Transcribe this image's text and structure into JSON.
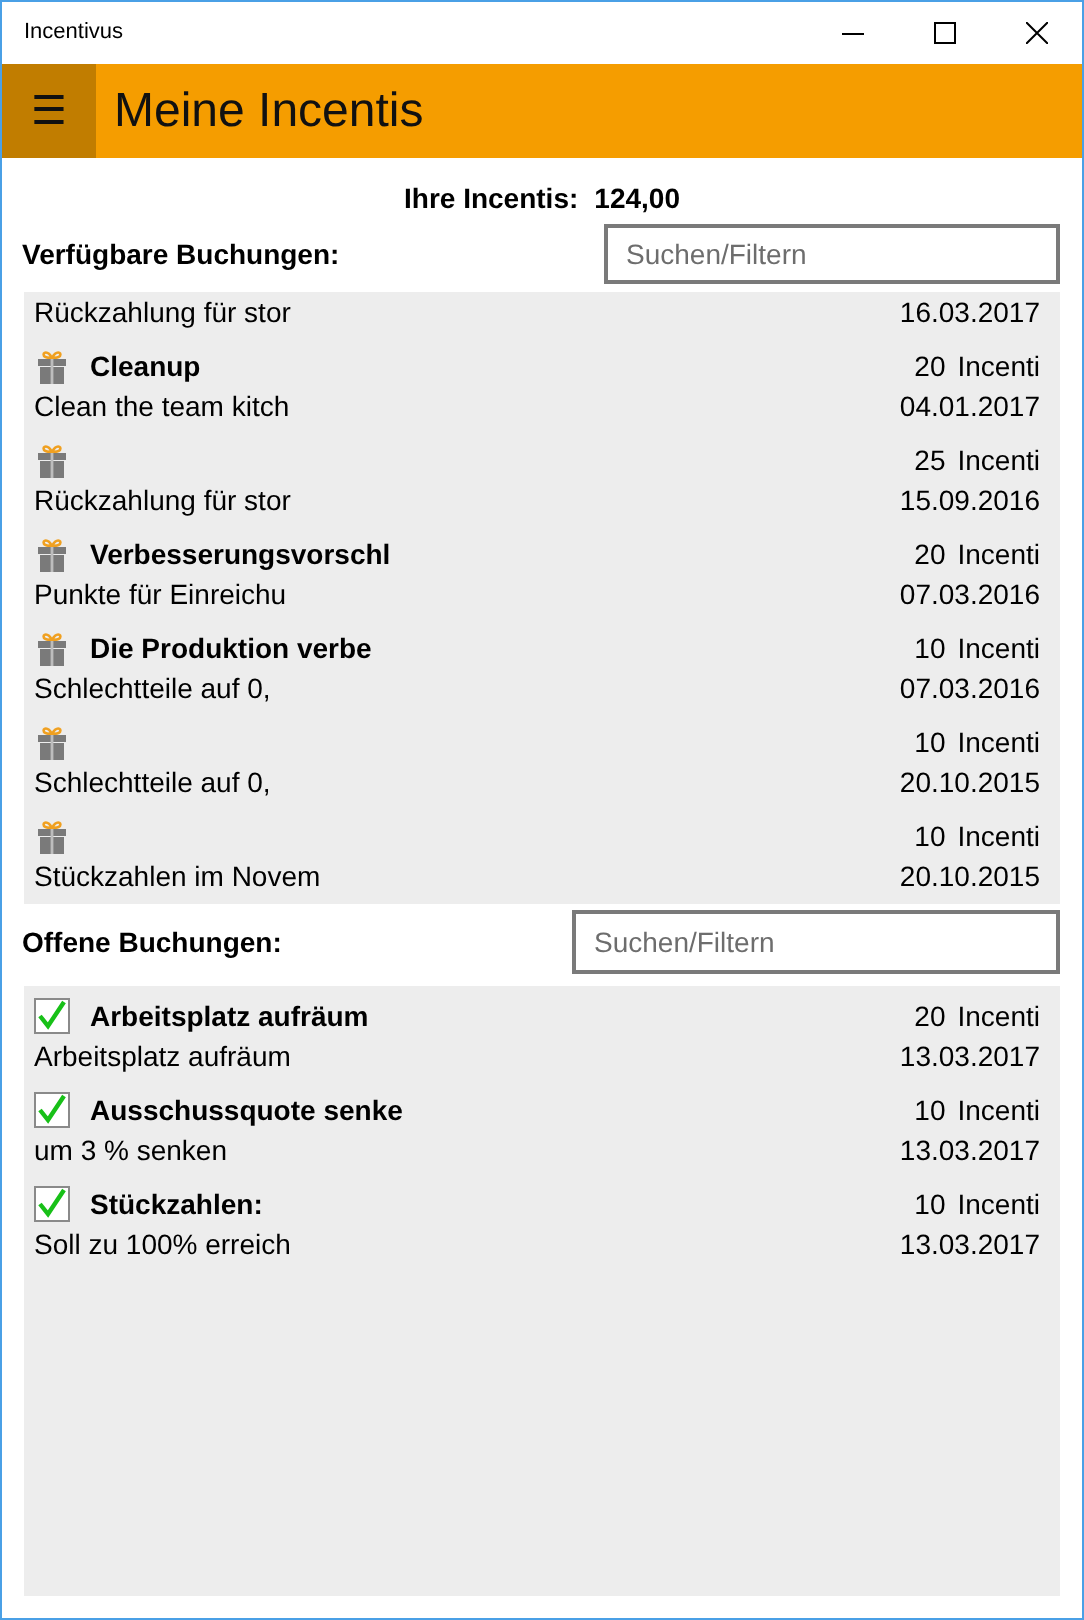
{
  "window": {
    "title": "Incentivus"
  },
  "header": {
    "menu_icon": "☰",
    "title": "Meine Incentis"
  },
  "total": {
    "label": "Ihre Incentis:",
    "value": "124,00"
  },
  "available": {
    "heading": "Verfügbare Buchungen:",
    "search": {
      "placeholder": "Suchen/Filtern"
    },
    "items": [
      {
        "description": "Rückzahlung für stor",
        "date": "16.03.2017"
      },
      {
        "kind": "gift",
        "title": "Cleanup",
        "points": "20",
        "unit": "Incenti",
        "description": "Clean the team kitch",
        "date": "04.01.2017"
      },
      {
        "kind": "gift",
        "points": "25",
        "unit": "Incenti",
        "description": "Rückzahlung für stor",
        "date": "15.09.2016"
      },
      {
        "kind": "gift",
        "title": "Verbesserungsvorschl",
        "points": "20",
        "unit": "Incenti",
        "description": "Punkte für Einreichu",
        "date": "07.03.2016"
      },
      {
        "kind": "gift",
        "title": "Die Produktion verbe",
        "points": "10",
        "unit": "Incenti",
        "description": "Schlechtteile auf 0,",
        "date": "07.03.2016"
      },
      {
        "kind": "gift",
        "points": "10",
        "unit": "Incenti",
        "description": "Schlechtteile auf 0,",
        "date": "20.10.2015"
      },
      {
        "kind": "gift",
        "points": "10",
        "unit": "Incenti",
        "description": "Stückzahlen im Novem",
        "date": "20.10.2015"
      }
    ]
  },
  "open": {
    "heading": "Offene Buchungen:",
    "search": {
      "placeholder": "Suchen/Filtern"
    },
    "items": [
      {
        "kind": "check",
        "title": "Arbeitsplatz aufräum",
        "points": "20",
        "unit": "Incenti",
        "description": "Arbeitsplatz aufräum",
        "date": "13.03.2017"
      },
      {
        "kind": "check",
        "title": "Ausschussquote senke",
        "points": "10",
        "unit": "Incenti",
        "description": "um 3 % senken",
        "date": "13.03.2017"
      },
      {
        "kind": "check",
        "title": "Stückzahlen:",
        "points": "10",
        "unit": "Incenti",
        "description": "Soll zu 100% erreich",
        "date": "13.03.2017"
      }
    ]
  }
}
